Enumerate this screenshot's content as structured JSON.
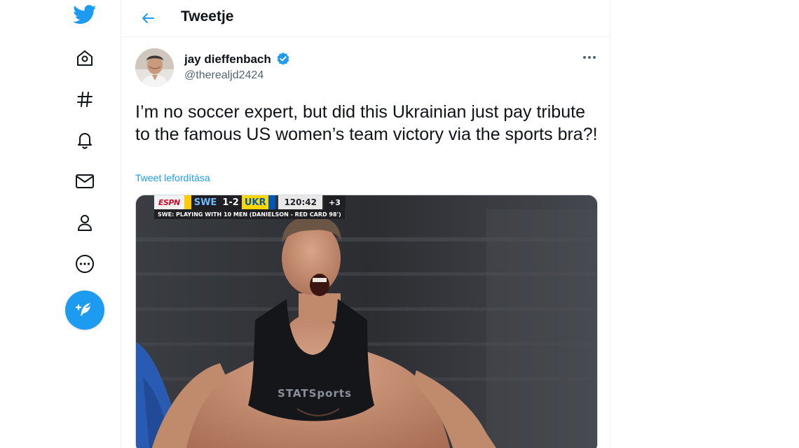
{
  "nav": {
    "items": [
      {
        "icon": "twitter-logo-icon"
      },
      {
        "icon": "home-icon"
      },
      {
        "icon": "explore-hashtag-icon"
      },
      {
        "icon": "notifications-bell-icon"
      },
      {
        "icon": "messages-envelope-icon"
      },
      {
        "icon": "profile-person-icon"
      },
      {
        "icon": "more-options-icon"
      }
    ],
    "compose_icon": "compose-feather-icon",
    "accent": "#1d9bf0"
  },
  "header": {
    "back_icon": "back-arrow-icon",
    "title": "Tweetje"
  },
  "tweet": {
    "author": {
      "name": "jay dieffenbach",
      "handle": "@therealjd2424",
      "verified": true
    },
    "text": "I’m no soccer expert, but did this Ukrainian just pay tribute to the famous US women’s team victory via the sports bra?!",
    "translate_label": "Tweet lefordítása",
    "media": {
      "scoreboard": {
        "network": "ESPN",
        "home": "SWE",
        "score": "1-2",
        "away": "UKR",
        "clock": "120:42",
        "added_time": "+3",
        "subtitle": "SWE: PLAYING WITH 10 MEN (DANIELSON - RED CARD 98')"
      },
      "shirt_logo": "STATSports"
    }
  }
}
